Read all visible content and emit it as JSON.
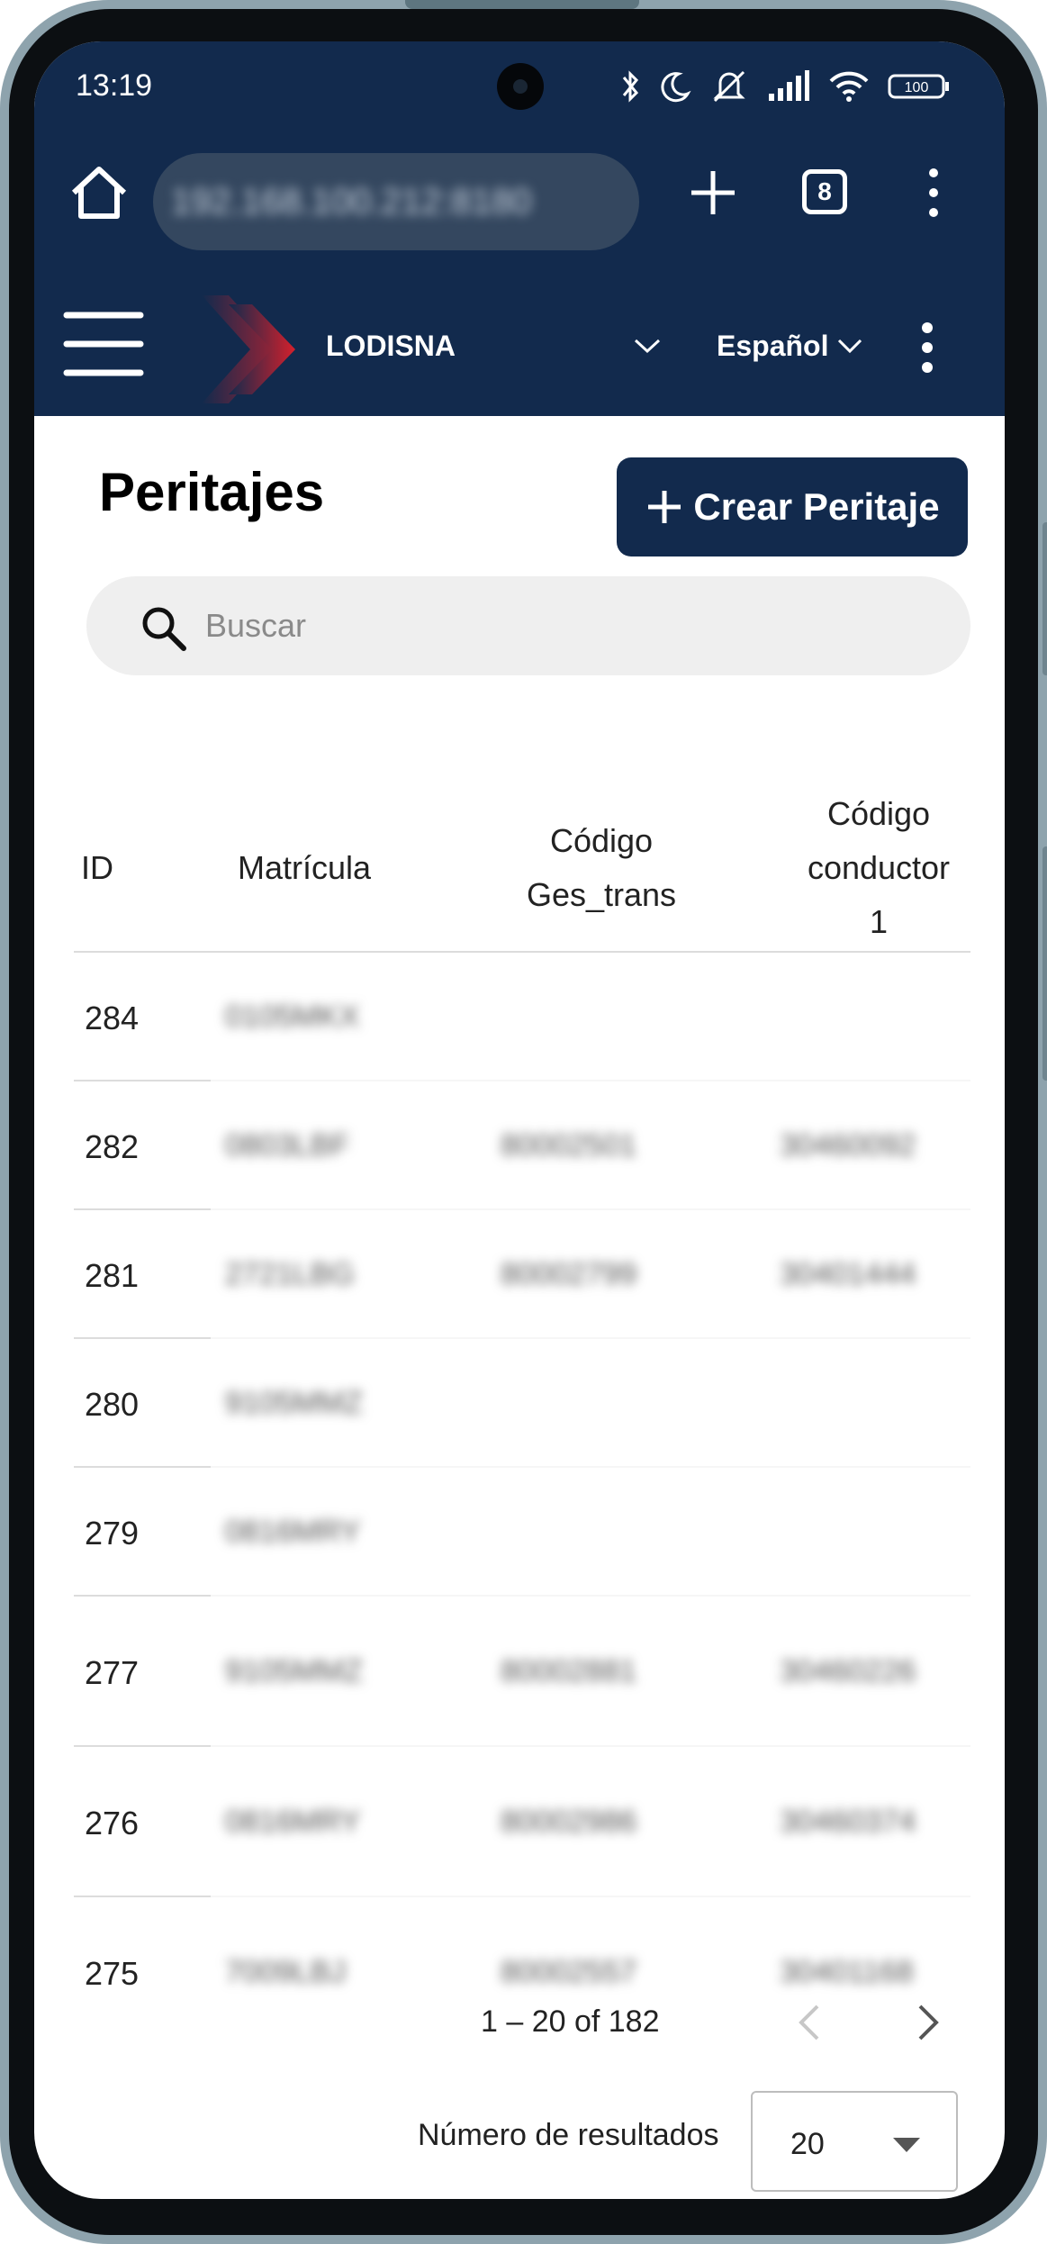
{
  "status_bar": {
    "time": "13:19",
    "battery": "100"
  },
  "browser": {
    "url": "192.168.100.212:8180",
    "tab_count": "8"
  },
  "app_bar": {
    "company": "LODISNA",
    "language": "Español"
  },
  "page": {
    "title": "Peritajes",
    "create_button": "Crear Peritaje",
    "search_placeholder": "Buscar"
  },
  "table": {
    "columns": {
      "id": "ID",
      "matricula": "Matrícula",
      "codigo_ges_trans": [
        "Código",
        "Ges_trans"
      ],
      "codigo_conductor": [
        "Código",
        "conductor",
        "1"
      ]
    },
    "rows": [
      {
        "id": "284",
        "matricula": "0105MKX",
        "ges_trans": "",
        "conductor": ""
      },
      {
        "id": "282",
        "matricula": "0803LBF",
        "ges_trans": "80002501",
        "conductor": "30460092"
      },
      {
        "id": "281",
        "matricula": "2721LBG",
        "ges_trans": "80002799",
        "conductor": "30401444"
      },
      {
        "id": "280",
        "matricula": "9105MMZ",
        "ges_trans": "",
        "conductor": ""
      },
      {
        "id": "279",
        "matricula": "0816MRY",
        "ges_trans": "",
        "conductor": ""
      },
      {
        "id": "277",
        "matricula": "9105MMZ",
        "ges_trans": "80002881",
        "conductor": "30460226"
      },
      {
        "id": "276",
        "matricula": "0816MRY",
        "ges_trans": "80002986",
        "conductor": "30460374"
      },
      {
        "id": "275",
        "matricula": "7009LBJ",
        "ges_trans": "80002557",
        "conductor": "30401168"
      }
    ]
  },
  "pagination": {
    "range": "1 – 20 of 182",
    "page_size_label": "Número de resultados",
    "page_size": "20"
  },
  "colors": {
    "primary": "#122a4d",
    "logo_red": "#d4202c"
  }
}
